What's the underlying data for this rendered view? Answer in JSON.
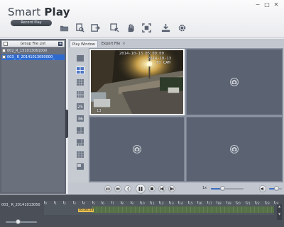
{
  "app": {
    "title_plain": "Smart ",
    "title_bold": "Play",
    "subtitle": "Record Play"
  },
  "toolbar": {
    "items": [
      {
        "name": "open-folder-icon"
      },
      {
        "name": "search-file-icon"
      },
      {
        "name": "export-icon"
      },
      {
        "name": "clip-icon"
      },
      {
        "name": "hand-icon"
      },
      {
        "name": "fullscreen-icon"
      },
      {
        "name": "download-icon"
      },
      {
        "name": "settings-icon"
      }
    ]
  },
  "window_controls": {
    "minimize": "−",
    "maximize": "□",
    "close": "✕"
  },
  "file_panel": {
    "header": "Group File List",
    "files": [
      {
        "label": "002_R_151013061000",
        "selected": false
      },
      {
        "label": "003_ R_20141013050000_",
        "selected": true
      }
    ]
  },
  "tabs": [
    {
      "label": "Play Window",
      "active": true
    },
    {
      "label": "Export File",
      "active": false,
      "close": "×"
    }
  ],
  "layout_buttons": [
    "1x1",
    "2x2",
    "3x3",
    "4x4",
    "5x5",
    "6x6",
    "1+5",
    "1+7",
    "1+9",
    "1+12"
  ],
  "video": {
    "osd_timestamp": "2014-10-13 05:00:00",
    "osd_camera": "TO CAM",
    "osd_channel": "13",
    "osd_date_line": "2014-10-13"
  },
  "controls": {
    "speed_label": "1x",
    "speed_fraction": 0.35,
    "volume_fraction": 0.55
  },
  "timeline": {
    "row_label": "003_ R_20141013050",
    "cursor_time": "05:00:53",
    "ticks": [
      "0",
      "1",
      "2",
      "3",
      "4",
      "5",
      "6",
      "7",
      "8",
      "9",
      "10",
      "11",
      "12",
      "13",
      "14",
      "15",
      "16",
      "17",
      "18",
      "19",
      "20",
      "21",
      "22",
      "23",
      "24"
    ],
    "recording_start_hour": 5,
    "recording_end_hour": 24
  }
}
